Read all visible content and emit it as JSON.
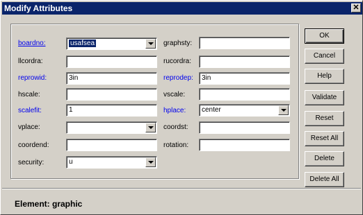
{
  "window": {
    "title": "Modify Attributes",
    "close_glyph": "✕"
  },
  "fields": {
    "boardno": {
      "label": "boardno:",
      "value": "usafsea"
    },
    "llcordra": {
      "label": "llcordra:",
      "value": ""
    },
    "reprowid": {
      "label": "reprowid:",
      "value": "3in"
    },
    "hscale": {
      "label": "hscale:",
      "value": ""
    },
    "scalefit": {
      "label": "scalefit:",
      "value": "1"
    },
    "vplace": {
      "label": "vplace:",
      "value": ""
    },
    "coordend": {
      "label": "coordend:",
      "value": ""
    },
    "security": {
      "label": "security:",
      "value": "u"
    },
    "graphsty": {
      "label": "graphsty:",
      "value": ""
    },
    "rucordra": {
      "label": "rucordra:",
      "value": ""
    },
    "reprodep": {
      "label": "reprodep:",
      "value": "3in"
    },
    "vscale": {
      "label": "vscale:",
      "value": ""
    },
    "hplace": {
      "label": "hplace:",
      "value": "center"
    },
    "coordst": {
      "label": "coordst:",
      "value": ""
    },
    "rotation": {
      "label": "rotation:",
      "value": ""
    }
  },
  "buttons": {
    "ok": "OK",
    "cancel": "Cancel",
    "help": "Help",
    "validate": "Validate",
    "reset": "Reset",
    "reset_all": "Reset All",
    "delete": "Delete",
    "delete_all": "Delete All"
  },
  "status": {
    "text": "Element: graphic"
  },
  "colors": {
    "title_bar": "#0a246a",
    "link_label": "#0000ee",
    "dialog_bg": "#d4d0c8"
  }
}
